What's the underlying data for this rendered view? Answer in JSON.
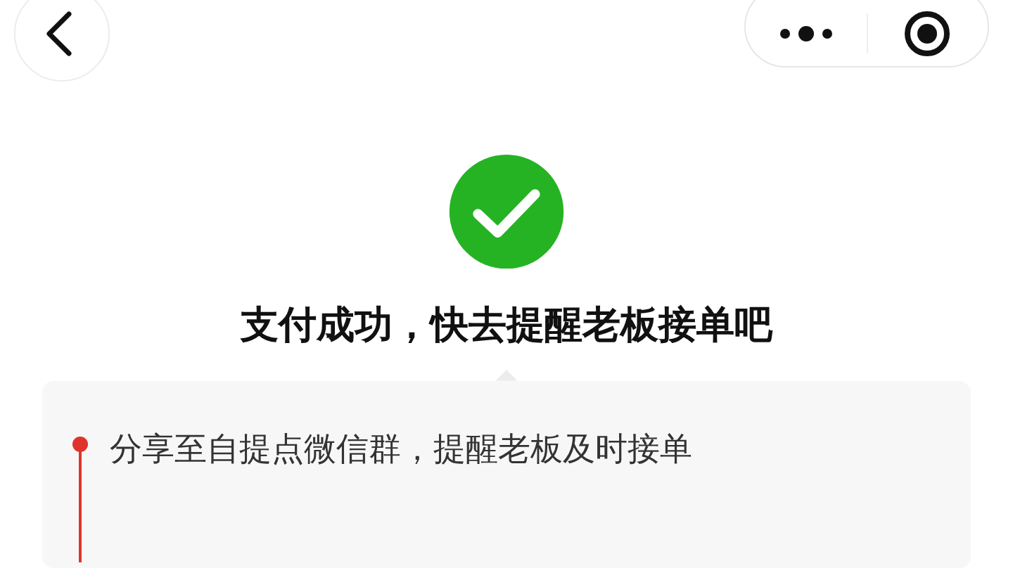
{
  "title": "支付成功，快去提醒老板接单吧",
  "steps": [
    {
      "text": "分享至自提点微信群，提醒老板及时接单"
    }
  ]
}
